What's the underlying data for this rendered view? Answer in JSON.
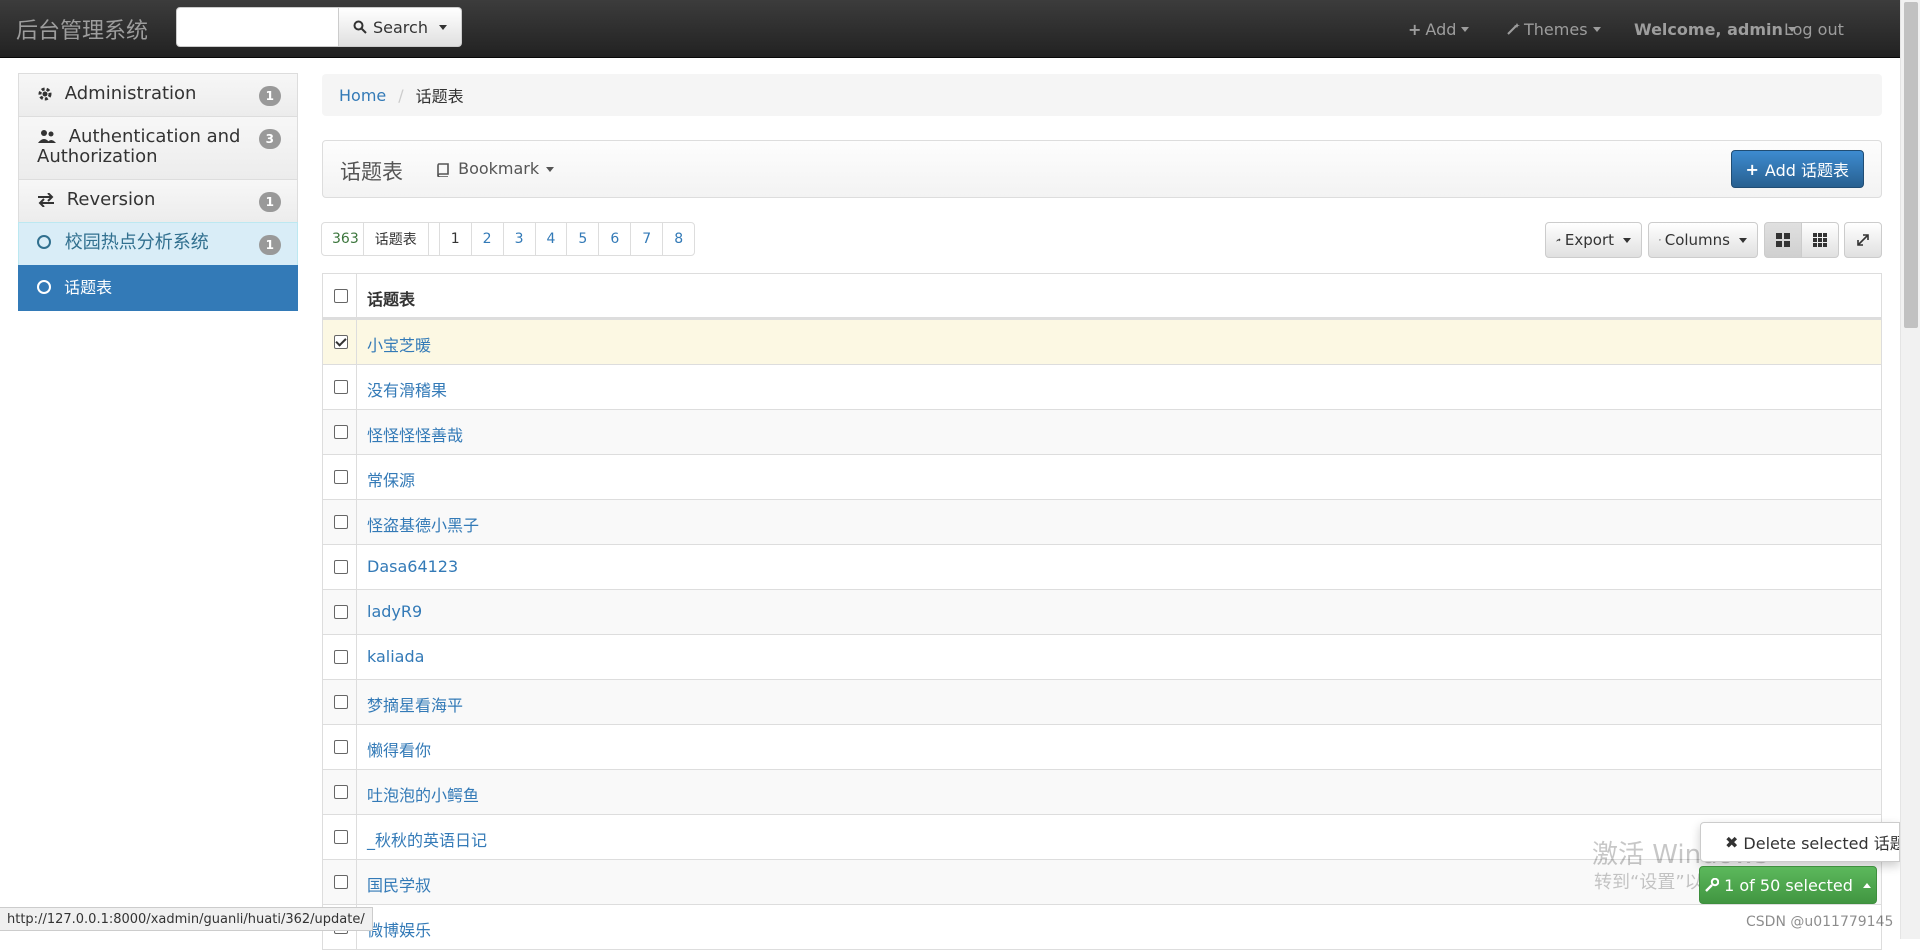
{
  "navbar": {
    "brand": "后台管理系统",
    "search_placeholder": "",
    "search_label": "Search",
    "add_label": "Add",
    "themes_label": "Themes",
    "welcome_label": "Welcome, admin",
    "logout_label": "Log out"
  },
  "sidebar": {
    "items": [
      {
        "label": "Administration",
        "badge": "1",
        "icon": "gear-icon"
      },
      {
        "label": "Authentication and Authorization",
        "badge": "3",
        "icon": "users-icon"
      },
      {
        "label": "Reversion",
        "badge": "1",
        "icon": "exchange-icon"
      },
      {
        "label": "校园热点分析系统",
        "badge": "1",
        "icon": "circle-icon"
      },
      {
        "label": "话题表",
        "icon": "circle-icon"
      }
    ]
  },
  "breadcrumb": {
    "home": "Home",
    "current": "话题表"
  },
  "title_panel": {
    "title": "话题表",
    "bookmark": "Bookmark",
    "add_button": "Add 话题表"
  },
  "pager": {
    "count": "363",
    "count_label": "话题表",
    "pages": [
      "1",
      "2",
      "3",
      "4",
      "5",
      "6",
      "7",
      "8"
    ]
  },
  "tools": {
    "export": "Export",
    "columns": "Columns"
  },
  "table": {
    "column_header": "话题表",
    "rows": [
      {
        "name": "小宝芝暖",
        "checked": true
      },
      {
        "name": "没有滑稽果",
        "checked": false
      },
      {
        "name": "怪怪怪怪善哉",
        "checked": false
      },
      {
        "name": "常保源",
        "checked": false
      },
      {
        "name": "怪盗基德小黑子",
        "checked": false
      },
      {
        "name": "Dasa64123",
        "checked": false
      },
      {
        "name": "ladyR9",
        "checked": false
      },
      {
        "name": "kaliada",
        "checked": false
      },
      {
        "name": "梦摘星看海平",
        "checked": false
      },
      {
        "name": "懒得看你",
        "checked": false
      },
      {
        "name": "吐泡泡的小鳄鱼",
        "checked": false
      },
      {
        "name": "_秋秋的英语日记",
        "checked": false
      },
      {
        "name": "国民学叔",
        "checked": false
      },
      {
        "name": "微博娱乐",
        "checked": false
      }
    ]
  },
  "actions": {
    "delete_selected": "Delete selected 话题表",
    "selected_status": "1 of 50 selected"
  },
  "status_bar_url": "http://127.0.0.1:8000/xadmin/guanli/huati/362/update/",
  "watermark": {
    "line1": "激活 Windows",
    "line2": "转到“设置”以激活 Windows。"
  },
  "csdn_credit": "CSDN @u011779145",
  "colors": {
    "primary": "#337ab7",
    "success": "#5cb85c",
    "selected_row": "#fcf8e3",
    "navbar": "#222222"
  }
}
